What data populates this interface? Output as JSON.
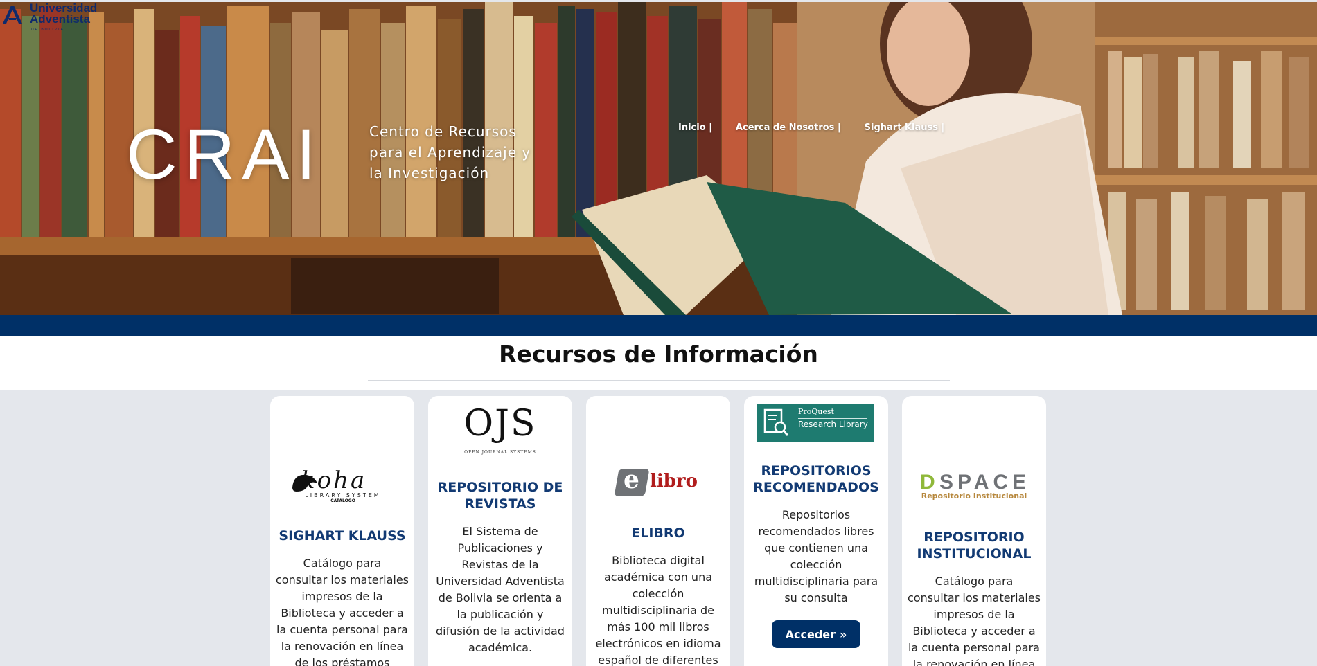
{
  "brand": {
    "logo_line1": "Universidad",
    "logo_line2": "Adventista",
    "logo_line3": "DE BOLIVIA"
  },
  "hero": {
    "title": "CRAI",
    "subtitle": "Centro de Recursos para el Aprendizaje y la Investigación"
  },
  "nav": {
    "items": [
      {
        "label": "Inicio |"
      },
      {
        "label": "Acerca de Nosotros |"
      },
      {
        "label": "Sighart Klauss |"
      }
    ]
  },
  "section": {
    "title": "Recursos de Información"
  },
  "cards": [
    {
      "logo_text": "koha",
      "logo_sub": "LIBRARY SYSTEM",
      "logo_sub2": "CATÁLOGO",
      "title": "SIGHART KLAUSS",
      "description": "Catálogo para consultar los materiales impresos de la Biblioteca y acceder a la cuenta personal para la renovación en línea de los préstamos"
    },
    {
      "logo_text": "OJS",
      "logo_sub": "OPEN JOURNAL SYSTEMS",
      "title": "REPOSITORIO DE REVISTAS",
      "description": "El Sistema de Publicaciones y Revistas de la Universidad Adventista de Bolivia se orienta a la publicación y difusión de la actividad académica."
    },
    {
      "logo_text_e": "e",
      "logo_text": "libro",
      "title": "ELIBRO",
      "description": "Biblioteca digital académica con una colección multidisciplinaria de más 100 mil libros electrónicos en idioma español de diferentes"
    },
    {
      "logo_text": "ProQuest",
      "logo_sub": "Research Library",
      "title": "REPOSITORIOS RECOMENDADOS",
      "description": "Repositorios recomendados libres que contienen una colección multidisciplinaria para su consulta",
      "button": "Acceder"
    },
    {
      "logo_text_d": "D",
      "logo_text": "SPACE",
      "logo_sub": "Repositorio Institucional",
      "title": "REPOSITORIO INSTITUCIONAL",
      "description": "Catálogo para consultar los materiales impresos de la Biblioteca y acceder a la cuenta personal para la renovación en línea de"
    }
  ],
  "colors": {
    "navy": "#003067",
    "card_title": "#123a73",
    "page_bg": "#e4e7ec"
  }
}
